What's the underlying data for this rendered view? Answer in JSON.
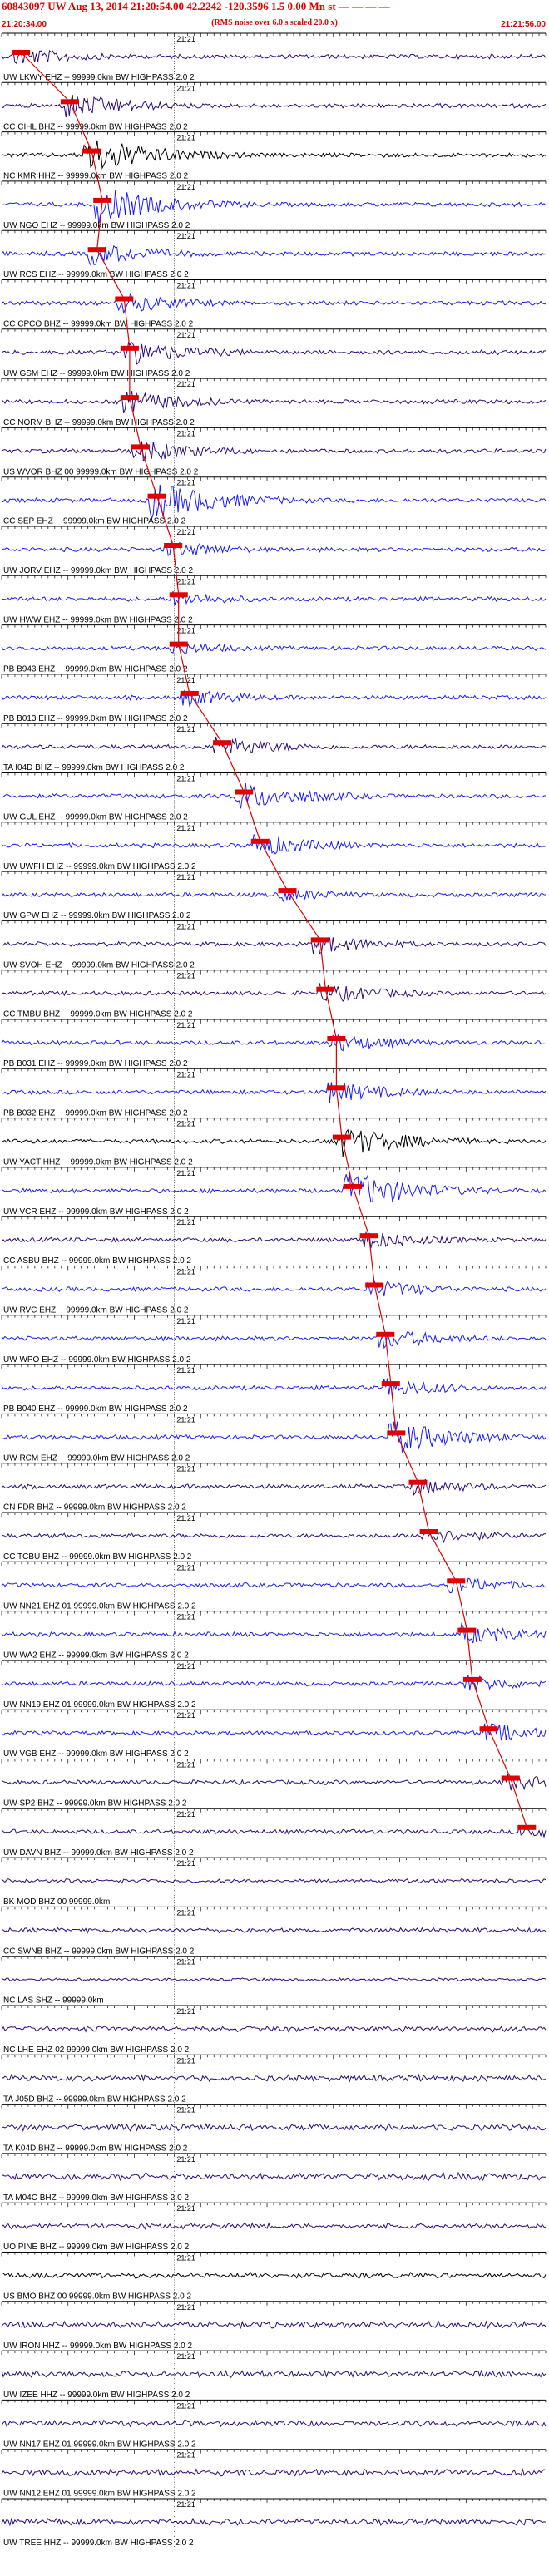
{
  "header": {
    "title": "60843097 UW Aug 13, 2014 21:20:54.00   42.2242 -120.3596  1.5 0.00 Mn st — — — —",
    "subtitle": "(RMS noise over 6.0 s scaled 20.0 x)",
    "start_time": "21:20:34.00",
    "end_time": "21:21:56.00"
  },
  "colors": {
    "blue": "#1a1aff",
    "navy": "#2a0a7a",
    "black": "#000000",
    "pick": "#e00000"
  },
  "chart_data": {
    "type": "seismogram",
    "traces": [
      {
        "label": "UW LKWY EHZ -- 99999.0km BW  HIGHPASS  2.0  2",
        "minute_label": "21:21",
        "color": "navy",
        "pick": 0.02,
        "amp": 0.5
      },
      {
        "label": "CC CIHL BHZ -- 99999.0km BW  HIGHPASS  2.0  2",
        "minute_label": "21:21",
        "color": "navy",
        "pick": 0.11,
        "amp": 0.7
      },
      {
        "label": "NC KMR HHZ -- 99999.0km BW  HIGHPASS  2.0  2",
        "minute_label": "21:21",
        "color": "black",
        "pick": 0.15,
        "amp": 1.0
      },
      {
        "label": "UW NGO EHZ -- 99999.0km BW  HIGHPASS  2.0  2",
        "minute_label": "21:21",
        "color": "blue",
        "pick": 0.17,
        "amp": 0.95
      },
      {
        "label": "UW RCS EHZ -- 99999.0km BW  HIGHPASS  2.0  2",
        "minute_label": "21:21",
        "color": "blue",
        "pick": 0.16,
        "amp": 0.6
      },
      {
        "label": "CC CPCO BHZ -- 99999.0km BW  HIGHPASS  2.0  2",
        "minute_label": "21:21",
        "color": "blue",
        "pick": 0.21,
        "amp": 0.55
      },
      {
        "label": "UW GSM EHZ -- 99999.0km BW  HIGHPASS  2.0  2",
        "minute_label": "21:21",
        "color": "navy",
        "pick": 0.22,
        "amp": 0.7
      },
      {
        "label": "CC NORM BHZ -- 99999.0km BW  HIGHPASS  2.0  2",
        "minute_label": "21:21",
        "color": "navy",
        "pick": 0.22,
        "amp": 0.6
      },
      {
        "label": "US WVOR BHZ 00 99999.0km BW  HIGHPASS  2.0  2",
        "minute_label": "21:21",
        "color": "navy",
        "pick": 0.24,
        "amp": 0.6
      },
      {
        "label": "CC SEP EHZ -- 99999.0km BW  HIGHPASS  2.0  2",
        "minute_label": "21:21",
        "color": "blue",
        "pick": 0.27,
        "amp": 1.0
      },
      {
        "label": "UW JORV EHZ -- 99999.0km BW  HIGHPASS  2.0  2",
        "minute_label": "21:21",
        "color": "blue",
        "pick": 0.3,
        "amp": 0.45
      },
      {
        "label": "UW HWW EHZ -- 99999.0km BW  HIGHPASS  2.0  2",
        "minute_label": "21:21",
        "color": "blue",
        "pick": 0.31,
        "amp": 0.4
      },
      {
        "label": "PB B943 EHZ -- 99999.0km BW  HIGHPASS  2.0  2",
        "minute_label": "21:21",
        "color": "blue",
        "pick": 0.31,
        "amp": 0.35
      },
      {
        "label": "PB B013 EHZ -- 99999.0km BW  HIGHPASS  2.0  2",
        "minute_label": "21:21",
        "color": "blue",
        "pick": 0.33,
        "amp": 0.45
      },
      {
        "label": "TA I04D BHZ -- 99999.0km BW  HIGHPASS  2.0  2",
        "minute_label": "21:21",
        "color": "navy",
        "pick": 0.39,
        "amp": 0.55
      },
      {
        "label": "UW GUL EHZ -- 99999.0km BW  HIGHPASS  2.0  2",
        "minute_label": "21:21",
        "color": "blue",
        "pick": 0.43,
        "amp": 0.75
      },
      {
        "label": "UW UWFH EHZ -- 99999.0km BW  HIGHPASS  2.0  2",
        "minute_label": "21:21",
        "color": "blue",
        "pick": 0.46,
        "amp": 0.6
      },
      {
        "label": "UW GPW EHZ -- 99999.0km BW  HIGHPASS  2.0  2",
        "minute_label": "21:21",
        "color": "blue",
        "pick": 0.51,
        "amp": 0.35
      },
      {
        "label": "UW SVOH EHZ -- 99999.0km BW  HIGHPASS  2.0  2",
        "minute_label": "21:21",
        "color": "navy",
        "pick": 0.57,
        "amp": 0.5
      },
      {
        "label": "CC TMBU BHZ -- 99999.0km BW  HIGHPASS  2.0  2",
        "minute_label": "21:21",
        "color": "navy",
        "pick": 0.58,
        "amp": 0.55
      },
      {
        "label": "PB B031 EHZ -- 99999.0km BW  HIGHPASS  2.0  2",
        "minute_label": "21:21",
        "color": "blue",
        "pick": 0.6,
        "amp": 0.5
      },
      {
        "label": "PB B032 EHZ -- 99999.0km BW  HIGHPASS  2.0  2",
        "minute_label": "21:21",
        "color": "blue",
        "pick": 0.6,
        "amp": 0.55
      },
      {
        "label": "UW YACT HHZ -- 99999.0km BW  HIGHPASS  2.0  2",
        "minute_label": "21:21",
        "color": "black",
        "pick": 0.61,
        "amp": 0.85
      },
      {
        "label": "UW VCR EHZ -- 99999.0km BW  HIGHPASS  2.0  2",
        "minute_label": "21:21",
        "color": "blue",
        "pick": 0.63,
        "amp": 1.0
      },
      {
        "label": "CC ASBU BHZ -- 99999.0km BW  HIGHPASS  2.0  2",
        "minute_label": "21:21",
        "color": "navy",
        "pick": 0.66,
        "amp": 0.5
      },
      {
        "label": "UW RVC EHZ -- 99999.0km BW  HIGHPASS  2.0  2",
        "minute_label": "21:21",
        "color": "blue",
        "pick": 0.67,
        "amp": 0.5
      },
      {
        "label": "UW WPO EHZ -- 99999.0km BW  HIGHPASS  2.0  2",
        "minute_label": "21:21",
        "color": "blue",
        "pick": 0.69,
        "amp": 0.55
      },
      {
        "label": "PB B040 EHZ -- 99999.0km BW  HIGHPASS  2.0  2",
        "minute_label": "21:21",
        "color": "blue",
        "pick": 0.7,
        "amp": 0.5
      },
      {
        "label": "UW RCM EHZ -- 99999.0km BW  HIGHPASS  2.0  2",
        "minute_label": "21:21",
        "color": "blue",
        "pick": 0.71,
        "amp": 0.9
      },
      {
        "label": "CN FDR BHZ -- 99999.0km BW  HIGHPASS  2.0  2",
        "minute_label": "21:21",
        "color": "navy",
        "pick": 0.75,
        "amp": 0.45
      },
      {
        "label": "CC TCBU BHZ -- 99999.0km BW  HIGHPASS  2.0  2",
        "minute_label": "21:21",
        "color": "navy",
        "pick": 0.77,
        "amp": 0.45
      },
      {
        "label": "UW NN21 EHZ 01 99999.0km BW  HIGHPASS  2.0  2",
        "minute_label": "21:21",
        "color": "blue",
        "pick": 0.82,
        "amp": 0.45
      },
      {
        "label": "UW WA2 EHZ -- 99999.0km BW  HIGHPASS  2.0  2",
        "minute_label": "21:21",
        "color": "blue",
        "pick": 0.84,
        "amp": 0.55
      },
      {
        "label": "UW NN19 EHZ 01 99999.0km BW  HIGHPASS  2.0  2",
        "minute_label": "21:21",
        "color": "blue",
        "pick": 0.85,
        "amp": 0.45
      },
      {
        "label": "UW VGB EHZ -- 99999.0km BW  HIGHPASS  2.0  2",
        "minute_label": "21:21",
        "color": "blue",
        "pick": 0.88,
        "amp": 0.55
      },
      {
        "label": "UW SP2 BHZ -- 99999.0km BW  HIGHPASS  2.0  2",
        "minute_label": "21:21",
        "color": "navy",
        "pick": 0.92,
        "amp": 0.45
      },
      {
        "label": "UW DAVN BHZ -- 99999.0km BW  HIGHPASS  2.0  2",
        "minute_label": "21:21",
        "color": "navy",
        "pick": 0.95,
        "amp": 0.4
      },
      {
        "label": "BK MOD BHZ 00 99999.0km",
        "minute_label": "21:21",
        "color": "navy",
        "pick": null,
        "amp": 0.25
      },
      {
        "label": "CC SWNB BHZ -- 99999.0km BW  HIGHPASS  2.0  2",
        "minute_label": "21:21",
        "color": "navy",
        "pick": null,
        "amp": 0.3
      },
      {
        "label": "NC LAS SHZ -- 99999.0km",
        "minute_label": "21:21",
        "color": "navy",
        "pick": null,
        "amp": 0.2
      },
      {
        "label": "NC LHE EHZ 02 99999.0km BW  HIGHPASS  2.0  2",
        "minute_label": "21:21",
        "color": "navy",
        "pick": null,
        "amp": 0.35
      },
      {
        "label": "TA J05D BHZ -- 99999.0km BW  HIGHPASS  2.0  2",
        "minute_label": "21:21",
        "color": "navy",
        "pick": null,
        "amp": 0.4
      },
      {
        "label": "TA K04D BHZ -- 99999.0km BW  HIGHPASS  2.0  2",
        "minute_label": "21:21",
        "color": "navy",
        "pick": null,
        "amp": 0.4
      },
      {
        "label": "TA M04C BHZ -- 99999.0km BW  HIGHPASS  2.0  2",
        "minute_label": "21:21",
        "color": "navy",
        "pick": null,
        "amp": 0.45
      },
      {
        "label": "UO PINE BHZ -- 99999.0km BW  HIGHPASS  2.0  2",
        "minute_label": "21:21",
        "color": "navy",
        "pick": null,
        "amp": 0.35
      },
      {
        "label": "US BMO BHZ 00 99999.0km BW  HIGHPASS  2.0  2",
        "minute_label": "21:21",
        "color": "black",
        "pick": null,
        "amp": 0.35
      },
      {
        "label": "UW IRON HHZ -- 99999.0km BW  HIGHPASS  2.0  2",
        "minute_label": "21:21",
        "color": "navy",
        "pick": null,
        "amp": 0.4
      },
      {
        "label": "UW IZEE HHZ -- 99999.0km BW  HIGHPASS  2.0  2",
        "minute_label": "21:21",
        "color": "navy",
        "pick": null,
        "amp": 0.4
      },
      {
        "label": "UW NN17 EHZ 01 99999.0km BW  HIGHPASS  2.0  2",
        "minute_label": "21:21",
        "color": "navy",
        "pick": null,
        "amp": 0.4
      },
      {
        "label": "UW NN12 EHZ 01 99999.0km BW  HIGHPASS  2.0  2",
        "minute_label": "21:21",
        "color": "navy",
        "pick": null,
        "amp": 0.4
      },
      {
        "label": "UW TREE HHZ -- 99999.0km BW  HIGHPASS  2.0  2",
        "minute_label": "21:21",
        "color": "navy",
        "pick": null,
        "amp": 0.4
      }
    ]
  }
}
